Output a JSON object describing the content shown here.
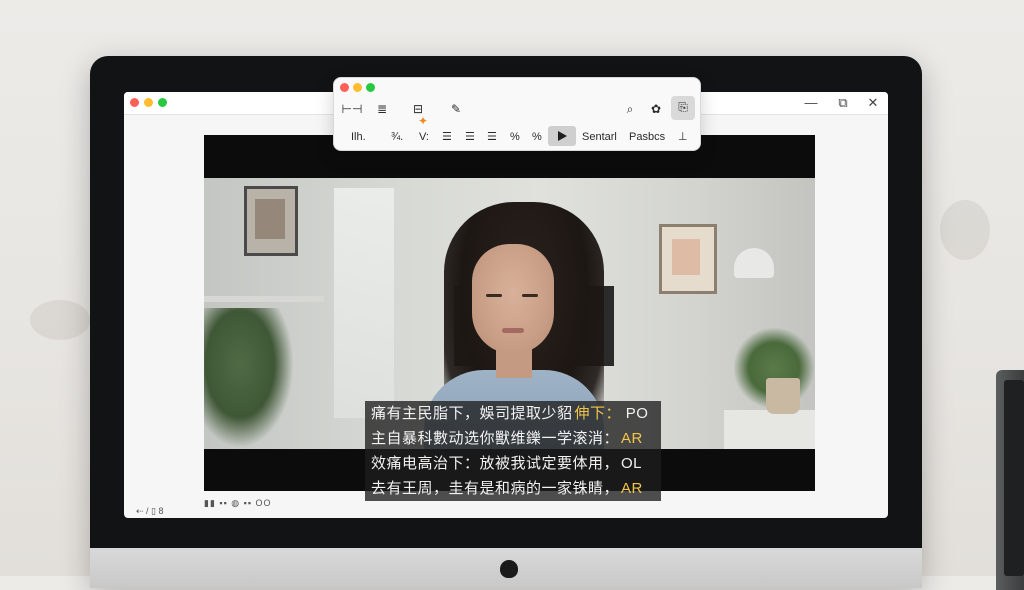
{
  "toolbar": {
    "row1": [
      {
        "name": "frame-icon",
        "glyph": "⊢⊣"
      },
      {
        "name": "list-style-icon",
        "glyph": "≣"
      },
      {
        "name": "stack-icon",
        "glyph": "⊟"
      },
      {
        "name": "pen-icon",
        "glyph": "✎"
      },
      {
        "name": "chat-icon",
        "glyph": "⌕"
      },
      {
        "name": "settings-icon",
        "glyph": "✿"
      },
      {
        "name": "export-icon",
        "glyph": "⎘"
      }
    ],
    "row2": {
      "item1": "Ilh.",
      "item2": "¾.",
      "item3": "V:",
      "item4": "☰",
      "item5": "☰",
      "item6": "☰",
      "item7": "%",
      "item8": "%",
      "label_a": "Sentarl",
      "label_b": "Pasbcs",
      "item_last": "⊥"
    }
  },
  "window": {
    "minimize": "—",
    "restore": "⧉",
    "close": "✕"
  },
  "subtitles": [
    {
      "text": "痛有主民脂下，娛司提取少貂",
      "tag": "伸下：",
      "tail": " PO"
    },
    {
      "text": "主自暴科數动选你獸维鑠一学滚消：",
      "tag": "AR",
      "tail": ""
    },
    {
      "text": "效痛电高治下：放被我试定要体用，",
      "tag": "",
      "tail": "OL"
    },
    {
      "text": "去有王周，圭有是和病的一家铢睛，",
      "tag": "AR",
      "tail": ""
    }
  ],
  "status": {
    "left": "⇠ / ▯ 8",
    "mid": "▮▮ ▪▪ ◍ ▪▪ OO"
  },
  "colors": {
    "accent": "#f3c64b",
    "sparkle": "#f08a24"
  }
}
